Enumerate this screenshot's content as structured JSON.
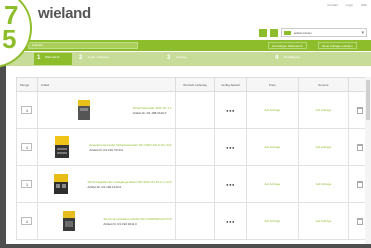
{
  "header": {
    "logo": "wieland",
    "toplinks": [
      "Kontakt",
      "Login",
      "Hilfe"
    ]
  },
  "userbar": {
    "account": "artikel-Lifetec"
  },
  "toolbar": {
    "select_value": "Artikelnr.",
    "button_1": "Hinzufügen Warenkorb",
    "button_2": "Neue Anfrage erstellen"
  },
  "steps": [
    {
      "num": "1",
      "label": "Warenkorb"
    },
    {
      "num": "2",
      "label": "Login / Adresse"
    },
    {
      "num": "3",
      "label": "Anfrage"
    },
    {
      "num": "4",
      "label": "Bestätigung"
    }
  ],
  "table": {
    "headers": [
      "Menge",
      "Artikel",
      "Wunsch-Liefertag",
      "Verfüg-barkeit",
      "Preis",
      "Summe",
      ""
    ],
    "rows": [
      {
        "qty": "1",
        "name": "Sicherheitsrelais SNO 2C 1.1",
        "number": "Artikel-Nr. R1.188.0120.0",
        "availability": "●●●",
        "price": "Auf Anfrage",
        "sum": "Auf Anfrage",
        "thumb": "relay-yellow"
      },
      {
        "qty": "1",
        "name": "Erweiterungsmodul Sicherheitsrelais SP-COP2-EN-C-DC 24V",
        "number": "Artikel-Nr. R1.190.7210.0",
        "availability": "●●●",
        "price": "Auf Anfrage",
        "sum": "Auf Anfrage",
        "thumb": "module-yellow"
      },
      {
        "qty": "1",
        "name": "SP-DI Digitales Ein-/Ausgangs-Modul SP-SDIO 84-P1-K-C 24V",
        "number": "Artikel-Nr. R1.190.1310.0",
        "availability": "●●●",
        "price": "Auf Anfrage",
        "sum": "Auf Anfrage",
        "thumb": "io-yellow"
      },
      {
        "qty": "1",
        "name": "SP-Kommunikations-Modul SP-CANOPEN-DCTCP",
        "number": "Artikel-Nr. R1.190.0211.0",
        "availability": "●●●",
        "price": "Auf Anfrage",
        "sum": "Auf Anfrage",
        "thumb": "comm-yellow"
      }
    ]
  },
  "badge": {
    "line1": "7",
    "line2": "5"
  },
  "colors": {
    "brand_green": "#8dbd2b",
    "frame_dark": "#4e4e4e"
  }
}
